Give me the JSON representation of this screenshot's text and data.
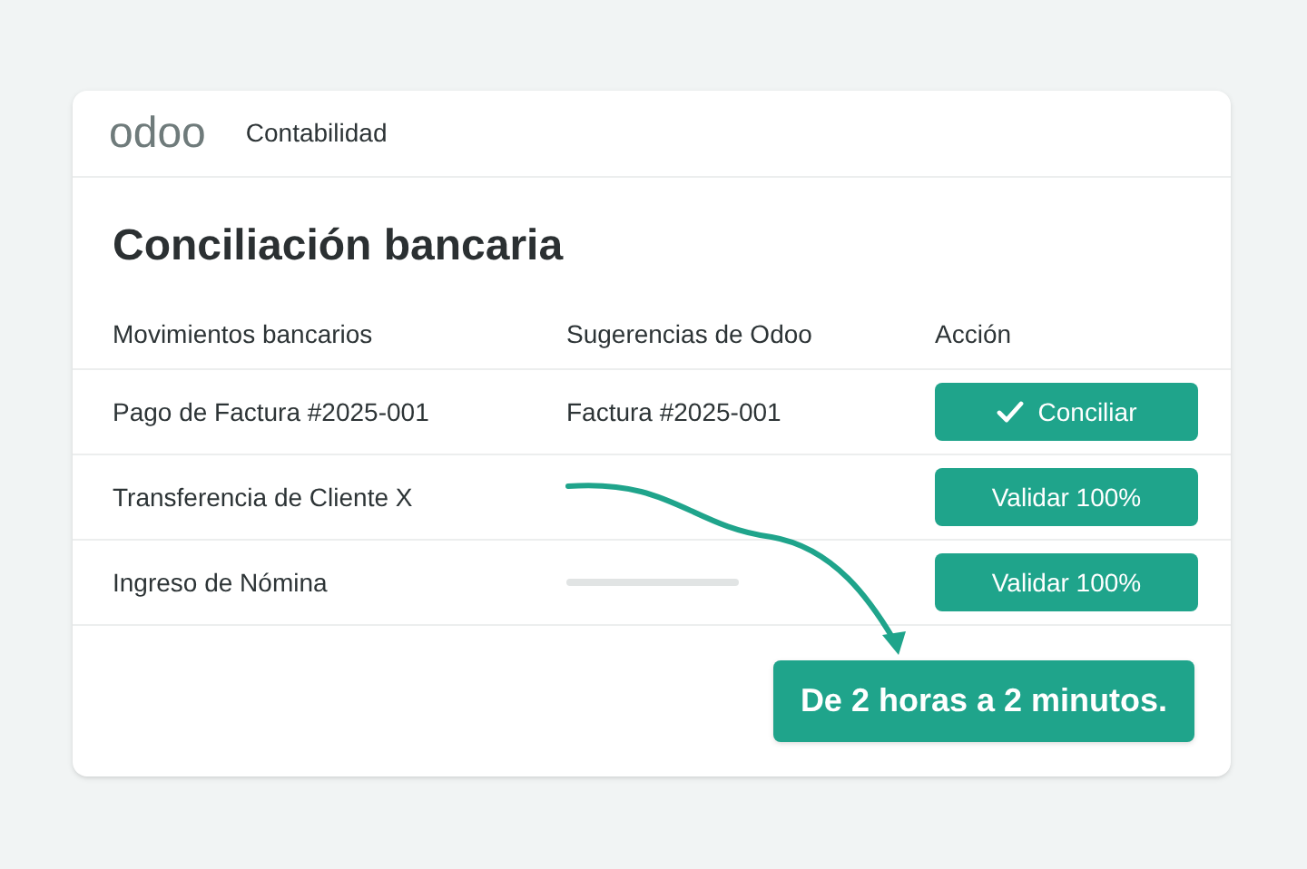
{
  "header": {
    "logo": "odoo",
    "app": "Contabilidad"
  },
  "title": "Conciliación bancaria",
  "table": {
    "columns": [
      "Movimientos bancarios",
      "Sugerencias de Odoo",
      "Acción"
    ],
    "rows": [
      {
        "movement": "Pago de Factura #2025-001",
        "suggestion": {
          "kind": "text",
          "text": "Factura #2025-001"
        },
        "action": {
          "label": "Conciliar",
          "check": true
        }
      },
      {
        "movement": "Transferencia de Cliente X",
        "suggestion": {
          "kind": "arrow"
        },
        "action": {
          "label": "Validar 100%",
          "check": false
        }
      },
      {
        "movement": "Ingreso de Nómina",
        "suggestion": {
          "kind": "placeholder"
        },
        "action": {
          "label": "Validar 100%",
          "check": false
        }
      }
    ]
  },
  "callout": "De 2 horas a 2 minutos."
}
